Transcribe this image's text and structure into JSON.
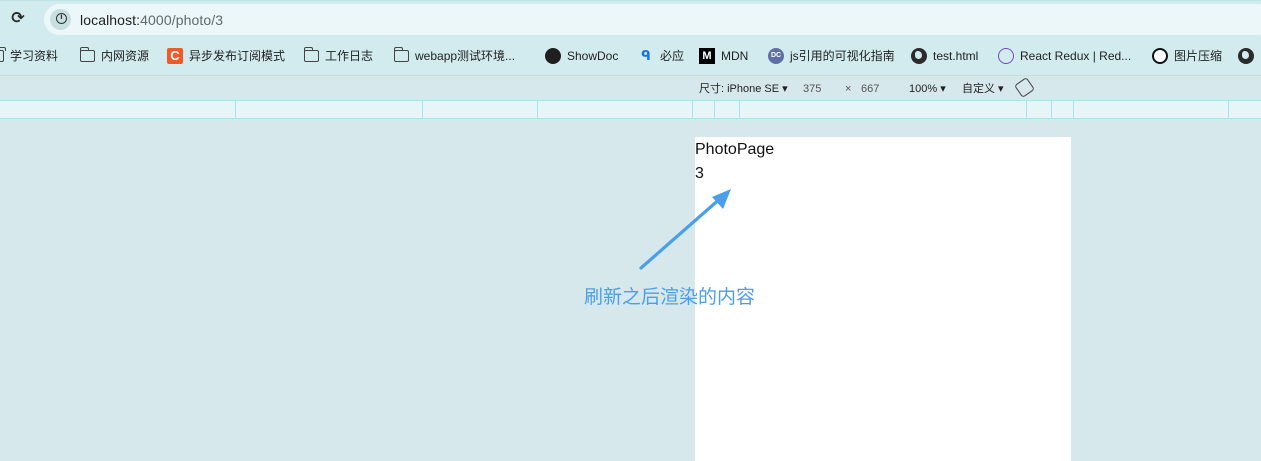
{
  "browser": {
    "url_host": "localhost:",
    "url_path": "4000/photo/3"
  },
  "bookmarks": [
    {
      "label": "学习资料",
      "icon": "folder-icon"
    },
    {
      "label": "内网资源",
      "icon": "folder-icon"
    },
    {
      "label": "异步发布订阅模式",
      "icon": "csdn-icon"
    },
    {
      "label": "工作日志",
      "icon": "folder-icon"
    },
    {
      "label": "webapp测试环境...",
      "icon": "folder-icon"
    },
    {
      "label": "ShowDoc",
      "icon": "showdoc-icon"
    },
    {
      "label": "必应",
      "icon": "search-icon"
    },
    {
      "label": "MDN",
      "icon": "mdn-icon"
    },
    {
      "label": "js引用的可视化指南",
      "icon": "dc-icon"
    },
    {
      "label": "test.html",
      "icon": "globe-icon"
    },
    {
      "label": "React Redux | Red...",
      "icon": "redux-icon"
    },
    {
      "label": "图片压缩",
      "icon": "panda-icon"
    }
  ],
  "device_toolbar": {
    "dimensions_label": "尺寸: iPhone SE",
    "width": "375",
    "times": "×",
    "height": "667",
    "zoom": "100%",
    "throttle": "自定义"
  },
  "viewport": {
    "title": "PhotoPage",
    "id": "3"
  },
  "annotation": {
    "text": "刷新之后渲染的内容",
    "color": "#4a9fea"
  }
}
